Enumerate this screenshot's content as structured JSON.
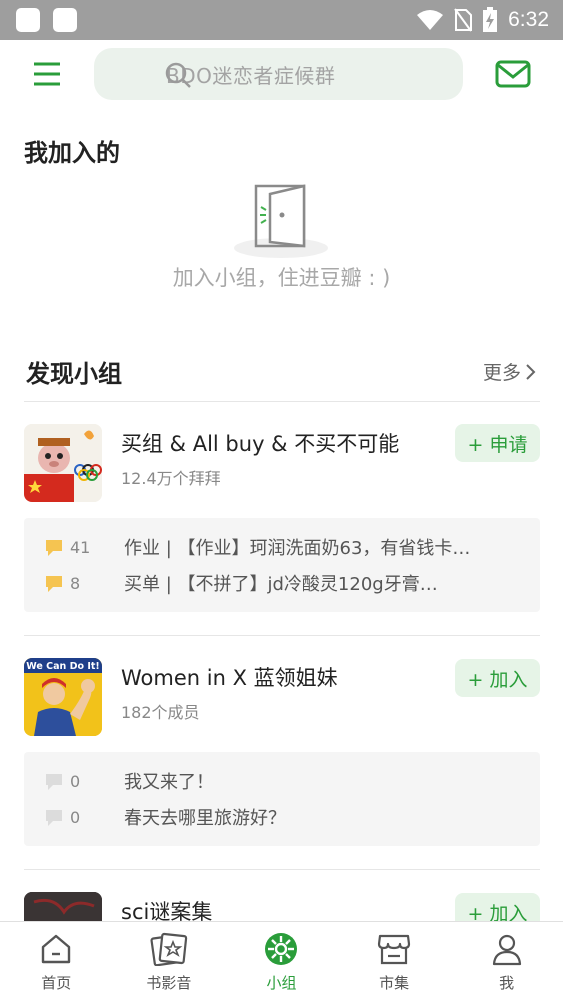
{
  "status_bar": {
    "time": "6:32"
  },
  "header": {
    "search_placeholder": "BDO迷恋者症候群"
  },
  "joined": {
    "title": "我加入的",
    "empty_text": "加入小组，住进豆瓣 : )"
  },
  "discover": {
    "title": "发现小组",
    "more_label": "更多",
    "groups": [
      {
        "name": "买组 & All buy & 不买不可能",
        "members": "12.4万个拜拜",
        "action": "+ 申请",
        "topics": [
          {
            "count": "41",
            "text": "作业 | 【作业】珂润洗面奶63，有省钱卡…",
            "icon_color": "#f5c451"
          },
          {
            "count": "8",
            "text": "买单 | 【不拼了】￼￼jd冷酸灵120g牙膏…",
            "icon_color": "#f5c451"
          }
        ]
      },
      {
        "name": "Women in X 蓝领姐妹",
        "members": "182个成员",
        "action": "+ 加入",
        "avatar_text": "We Can Do It!",
        "topics": [
          {
            "count": "0",
            "text": "我又来了！",
            "icon_color": "#dcdcdc"
          },
          {
            "count": "0",
            "text": "春天去哪里旅游好？",
            "icon_color": "#dcdcdc"
          }
        ]
      },
      {
        "name": "sci谜案集",
        "action": "+ 加入"
      }
    ]
  },
  "bottom_nav": [
    {
      "label": "首页",
      "icon": "home-icon"
    },
    {
      "label": "书影音",
      "icon": "media-card-icon"
    },
    {
      "label": "小组",
      "icon": "group-icon",
      "active": true
    },
    {
      "label": "市集",
      "icon": "market-icon"
    },
    {
      "label": "我",
      "icon": "profile-icon"
    }
  ],
  "colors": {
    "accent": "#2a9d3a",
    "search_bg": "#ebf2ec",
    "status_bar": "#9e9e9e"
  }
}
